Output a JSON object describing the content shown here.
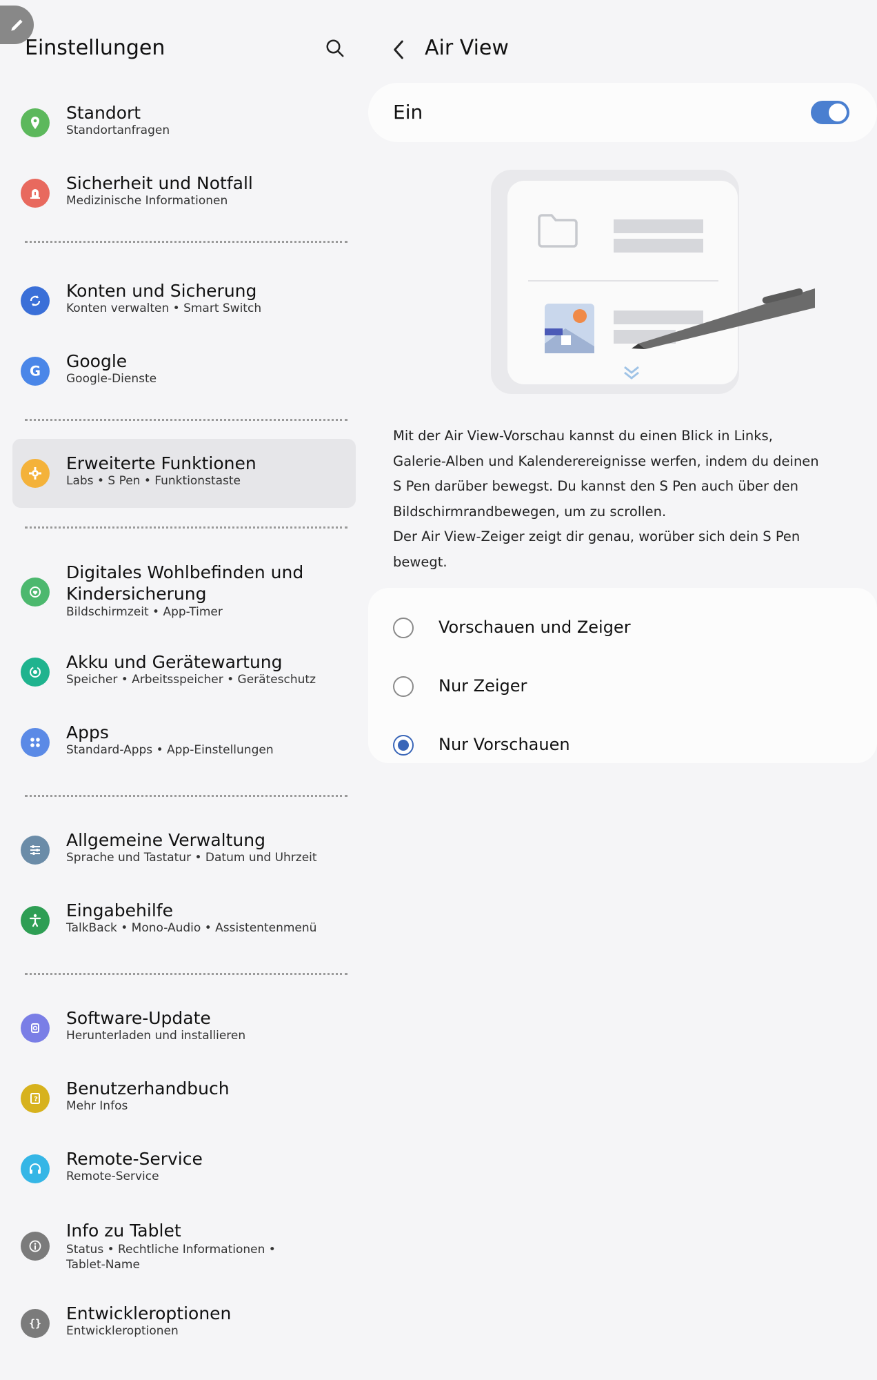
{
  "left": {
    "title": "Einstellungen",
    "items": [
      {
        "title": "Standort",
        "sub": "Standortanfragen",
        "icon": "location-icon",
        "color": "#5cb85c"
      },
      {
        "title": "Sicherheit und Notfall",
        "sub": "Medizinische Informationen",
        "icon": "emergency-icon",
        "color": "#e8695e"
      },
      {
        "title": "Konten und Sicherung",
        "sub": "Konten verwalten • Smart Switch",
        "icon": "sync-icon",
        "color": "#3a6fd8"
      },
      {
        "title": "Google",
        "sub": "Google-Dienste",
        "icon": "google-icon",
        "color": "#4a86e8"
      },
      {
        "title": "Erweiterte Funktionen",
        "sub": "Labs • S Pen • Funktionstaste",
        "icon": "star-gear-icon",
        "color": "#f4b23a"
      },
      {
        "title": "Digitales Wohlbefinden und Kindersicherung",
        "sub": "Bildschirmzeit • App-Timer",
        "icon": "wellbeing-icon",
        "color": "#4cb86e"
      },
      {
        "title": "Akku und Gerätewartung",
        "sub": "Speicher • Arbeitsspeicher • Geräteschutz",
        "icon": "battery-care-icon",
        "color": "#1fb38e"
      },
      {
        "title": "Apps",
        "sub": "Standard-Apps • App-Einstellungen",
        "icon": "apps-icon",
        "color": "#5b8ae6"
      },
      {
        "title": "Allgemeine Verwaltung",
        "sub": "Sprache und Tastatur • Datum und Uhrzeit",
        "icon": "sliders-icon",
        "color": "#6b8ca8"
      },
      {
        "title": "Eingabehilfe",
        "sub": "TalkBack • Mono-Audio • Assistentenmenü",
        "icon": "accessibility-icon",
        "color": "#2e9e54"
      },
      {
        "title": "Software-Update",
        "sub": "Herunterladen und installieren",
        "icon": "update-icon",
        "color": "#7a7ee6"
      },
      {
        "title": "Benutzerhandbuch",
        "sub": "Mehr Infos",
        "icon": "manual-icon",
        "color": "#d7b21d"
      },
      {
        "title": "Remote-Service",
        "sub": "Remote-Service",
        "icon": "headset-icon",
        "color": "#35b6e6"
      },
      {
        "title": "Info zu Tablet",
        "sub": "Status • Rechtliche Informationen • Tablet-Name",
        "icon": "info-icon",
        "color": "#7b7b7b"
      },
      {
        "title": "Entwickleroptionen",
        "sub": "Entwickleroptionen",
        "icon": "braces-icon",
        "color": "#7b7b7b"
      }
    ]
  },
  "right": {
    "title": "Air View",
    "toggle": {
      "label": "Ein",
      "on": true
    },
    "description": "Mit der Air View-Vorschau kannst du einen Blick in Links, Galerie-Alben und Kalenderereignisse werfen, indem du deinen S Pen darüber bewegst. Du kannst den S Pen auch über den Bildschirmrandbewegen, um zu scrollen.\nDer Air View-Zeiger zeigt dir genau, worüber sich dein S Pen bewegt.",
    "description_lines": [
      "Mit der Air View-Vorschau kannst du einen Blick in Links,",
      "Galerie-Alben und Kalenderereignisse werfen, indem du deinen",
      "S Pen darüber bewegst. Du kannst den S Pen auch über den",
      "Bildschirmrandbewegen, um zu scrollen.",
      "Der Air View-Zeiger zeigt dir genau, worüber sich dein S Pen",
      "bewegt."
    ],
    "options": [
      {
        "label": "Vorschauen und Zeiger",
        "checked": false
      },
      {
        "label": "Nur Zeiger",
        "checked": false
      },
      {
        "label": "Nur Vorschauen",
        "checked": true
      }
    ]
  },
  "colors": {
    "accent": "#3a66b8",
    "switch": "#4a7fd0",
    "background": "#f5f5f7"
  }
}
